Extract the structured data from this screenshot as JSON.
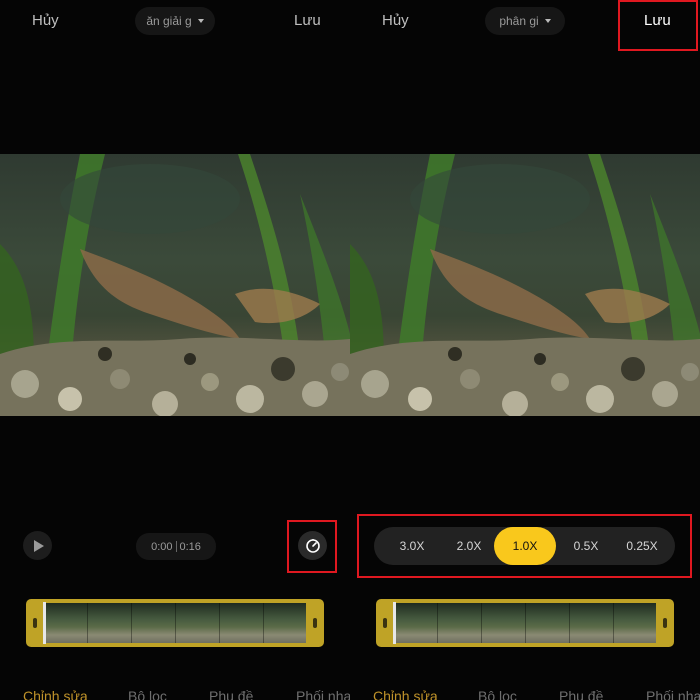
{
  "left": {
    "cancel_label": "Hủy",
    "resolution_text": "ăn giải g",
    "save_label": "Lưu",
    "time_current": "0:00",
    "time_total": "0:16",
    "tabs": [
      "Chỉnh sửa",
      "Bộ lọc",
      "Phụ đề",
      "Phối nhạ"
    ]
  },
  "right": {
    "cancel_label": "Hủy",
    "resolution_text": "phân gi",
    "save_label": "Lưu",
    "speed_options": [
      "3.0X",
      "2.0X",
      "1.0X",
      "0.5X",
      "0.25X"
    ],
    "selected_speed": "1.0X",
    "tabs": [
      "Chỉnh sửa",
      "Bộ lọc",
      "Phụ đề",
      "Phối nhạ"
    ]
  },
  "icons": {
    "play": "play-icon",
    "speed": "speedometer-icon",
    "dropdown": "caret-down-icon"
  },
  "colors": {
    "accent": "#f9c81c",
    "timeline_frame": "#bfa326",
    "active_tab": "#c0932a",
    "highlight": "#e01820"
  }
}
